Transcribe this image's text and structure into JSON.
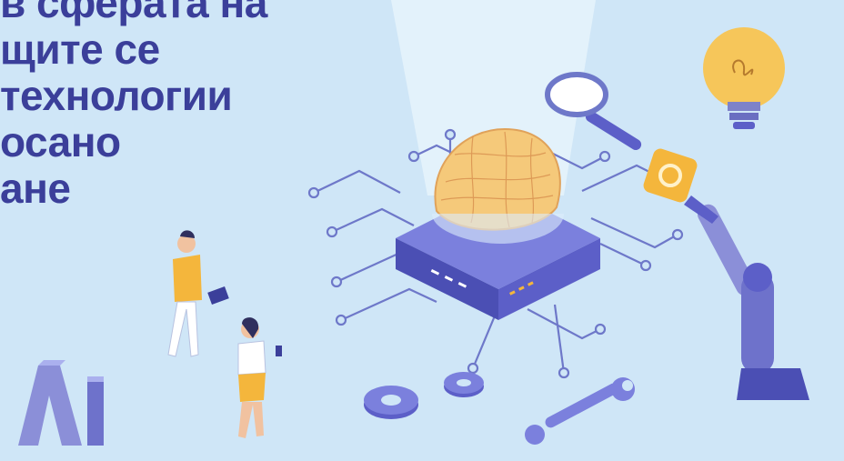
{
  "headline": {
    "lines": [
      "",
      "в сферата на",
      "щите се",
      " технологии",
      "осано",
      "ане"
    ]
  },
  "illustration": {
    "icons": [
      "brain-chip-icon",
      "magnifier-icon",
      "lightbulb-icon",
      "gear-icon",
      "robot-arm-icon",
      "wrench-icon",
      "ai-letters-icon"
    ],
    "colors": {
      "background": "#cfe6f7",
      "headline": "#3b3f9a",
      "chip": "#5c5fc8",
      "brain": "#f5c97a",
      "accent": "#f4b63c",
      "circuit": "#6e78c9"
    }
  }
}
